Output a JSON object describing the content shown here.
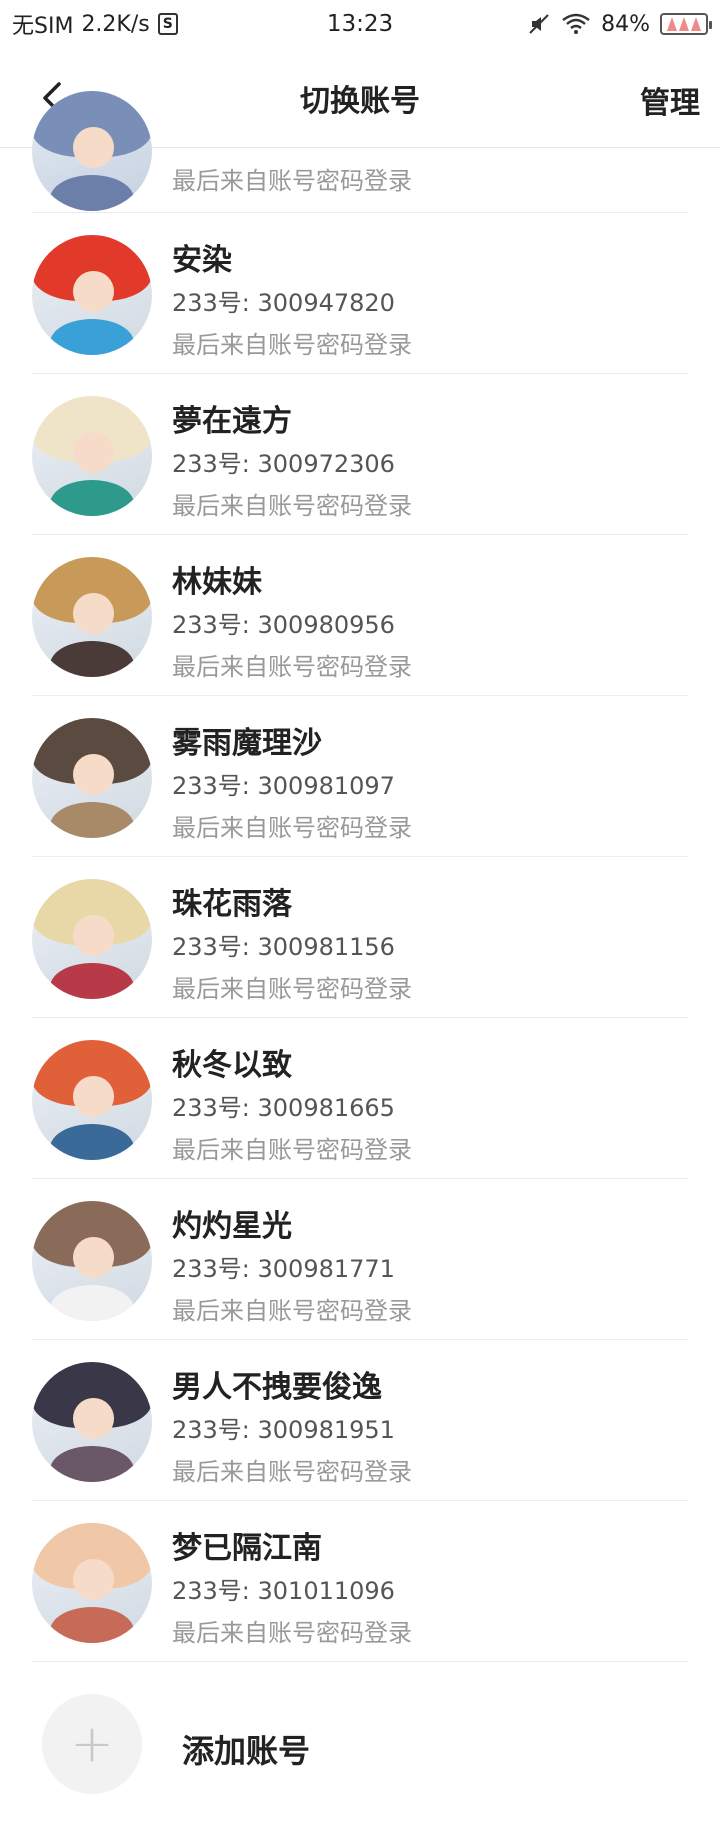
{
  "status_bar": {
    "carrier": "无SIM",
    "speed": "2.2K/s",
    "sim_badge": "S",
    "time": "13:23",
    "battery": "84%"
  },
  "nav": {
    "title": "切换账号",
    "manage": "管理"
  },
  "partial_account": {
    "login_method": "最后来自账号密码登录",
    "hair": "#7a8fb8",
    "body": "#6b7fa8"
  },
  "accounts": [
    {
      "name": "安染",
      "uid": "233号: 300947820",
      "login_method": "最后来自账号密码登录",
      "hair": "#e23a2a",
      "body": "#3aa0d8"
    },
    {
      "name": "夢在遠方",
      "uid": "233号: 300972306",
      "login_method": "最后来自账号密码登录",
      "hair": "#efe4c8",
      "body": "#2e9a8c"
    },
    {
      "name": "林妹妹",
      "uid": "233号: 300980956",
      "login_method": "最后来自账号密码登录",
      "hair": "#c89a5a",
      "body": "#4a3a38"
    },
    {
      "name": "雾雨魔理沙",
      "uid": "233号: 300981097",
      "login_method": "最后来自账号密码登录",
      "hair": "#5a4a40",
      "body": "#a88a68"
    },
    {
      "name": "珠花雨落",
      "uid": "233号: 300981156",
      "login_method": "最后来自账号密码登录",
      "hair": "#e8d8a8",
      "body": "#b83a48"
    },
    {
      "name": "秋冬以致",
      "uid": "233号: 300981665",
      "login_method": "最后来自账号密码登录",
      "hair": "#e0603a",
      "body": "#3a6a98"
    },
    {
      "name": "灼灼星光",
      "uid": "233号: 300981771",
      "login_method": "最后来自账号密码登录",
      "hair": "#8a6a58",
      "body": "#f2f2f2"
    },
    {
      "name": "男人不拽要俊逸",
      "uid": "233号: 300981951",
      "login_method": "最后来自账号密码登录",
      "hair": "#3a3848",
      "body": "#6a5868"
    },
    {
      "name": "梦已隔江南",
      "uid": "233号: 301011096",
      "login_method": "最后来自账号密码登录",
      "hair": "#f0c8a8",
      "body": "#c86a58"
    }
  ],
  "add_account": {
    "icon": "+",
    "label": "添加账号"
  }
}
